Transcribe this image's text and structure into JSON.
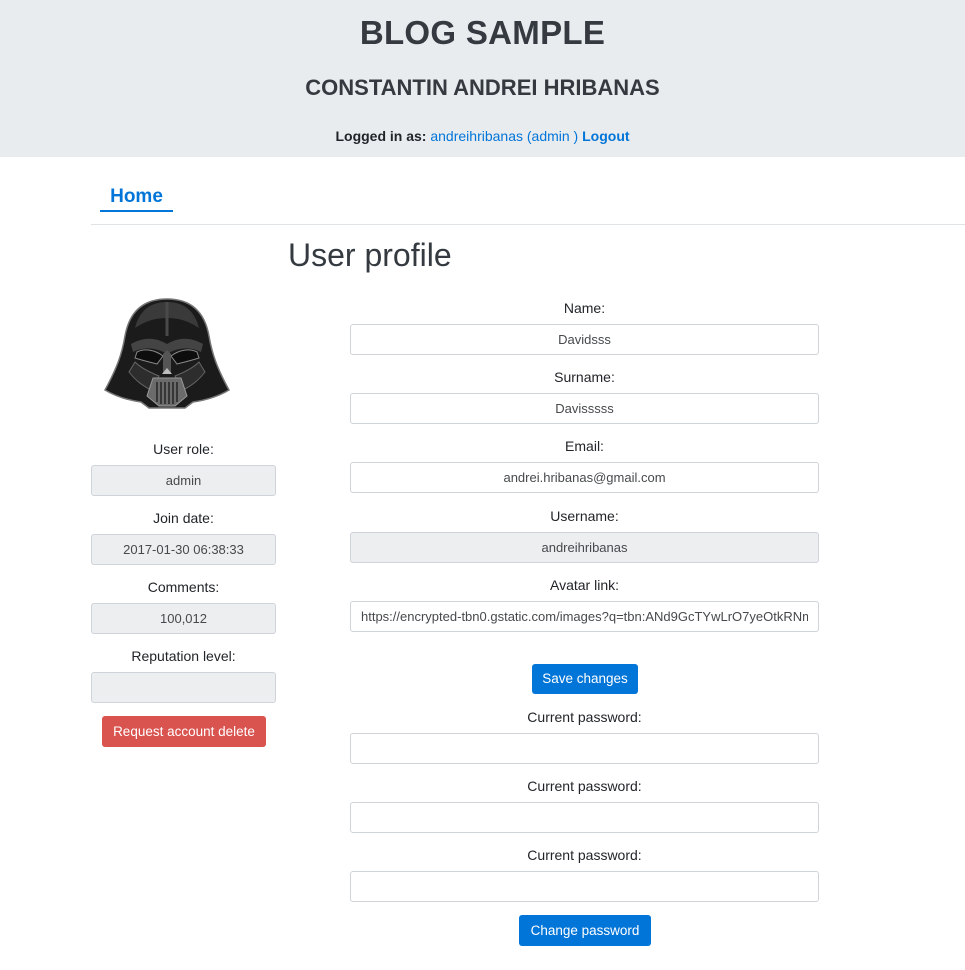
{
  "header": {
    "site_title": "BLOG SAMPLE",
    "author_name": "CONSTANTIN ANDREI HRIBANAS",
    "logged_in_label": "Logged in as:",
    "logged_in_user": "andreihribanas (admin )",
    "logout_label": "Logout"
  },
  "nav": {
    "home_label": "Home"
  },
  "page": {
    "title": "User profile"
  },
  "sidebar": {
    "avatar_icon": "darth-vader-helmet-icon",
    "user_role_label": "User role:",
    "user_role_value": "admin",
    "join_date_label": "Join date:",
    "join_date_value": "2017-01-30 06:38:33",
    "comments_label": "Comments:",
    "comments_value": "100,012",
    "reputation_label": "Reputation level:",
    "reputation_value": "",
    "delete_button": "Request account delete"
  },
  "profile_form": {
    "name_label": "Name:",
    "name_value": "Davidsss",
    "surname_label": "Surname:",
    "surname_value": "Davisssss",
    "email_label": "Email:",
    "email_value": "andrei.hribanas@gmail.com",
    "username_label": "Username:",
    "username_value": "andreihribanas",
    "avatar_label": "Avatar link:",
    "avatar_value": "https://encrypted-tbn0.gstatic.com/images?q=tbn:ANd9GcTYwLrO7yeOtkRNm",
    "save_button": "Save changes"
  },
  "password_form": {
    "field1_label": "Current password:",
    "field1_value": "",
    "field2_label": "Current password:",
    "field2_value": "",
    "field3_label": "Current password:",
    "field3_value": "",
    "change_button": "Change password"
  },
  "colors": {
    "header_bg": "#e9ecef",
    "link": "#0275d8",
    "primary_button": "#0275d8",
    "danger_button": "#d9534f",
    "readonly_bg": "#eceeef"
  }
}
